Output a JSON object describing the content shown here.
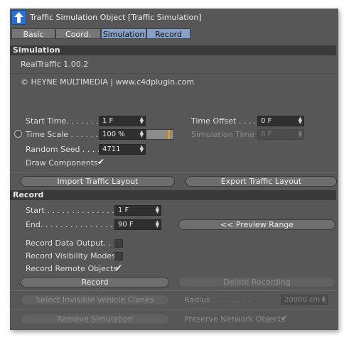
{
  "window": {
    "title": "Traffic Simulation Object [Traffic Simulation]"
  },
  "tabs": [
    {
      "label": "Basic",
      "active": false
    },
    {
      "label": "Coord.",
      "active": false
    },
    {
      "label": "Simulation",
      "active": true
    },
    {
      "label": "Record",
      "active": true
    }
  ],
  "simulation": {
    "header": "Simulation",
    "version": "RealTraffic 1.00.2",
    "copyright": "© HEYNE MULTIMEDIA  |  www.c4dplugin.com",
    "start_time": {
      "label": "Start Time. . . . . . . . .",
      "value": "1 F"
    },
    "time_offset": {
      "label": "Time Offset . . . .",
      "value": "0 F"
    },
    "time_scale": {
      "label": "Time Scale . . . . . . . .",
      "value": "100 %",
      "slider_fraction": 0.85
    },
    "simulation_time": {
      "label": "Simulation Time",
      "value": "0 F"
    },
    "random_seed": {
      "label": "Random Seed . . . .",
      "value": "4711"
    },
    "draw_components": {
      "label": "Draw Components",
      "checked": true
    },
    "import_button": "Import Traffic Layout",
    "export_button": "Export Traffic Layout"
  },
  "record": {
    "header": "Record",
    "start": {
      "label": "Start . . . . . . . . . . . . . . . .",
      "value": "1 F"
    },
    "end": {
      "label": "End. . . . . . . . . . . . . . . . . .",
      "value": "90 F"
    },
    "preview_button": "<< Preview Range",
    "record_data_output": {
      "label": "Record Data Output. . .",
      "checked": false
    },
    "record_visibility_modes": {
      "label": "Record Visibility Modes",
      "checked": false
    },
    "record_remote_objects": {
      "label": "Record Remote Objects",
      "checked": true
    },
    "record_button": "Record",
    "delete_button": "Delete Recording",
    "select_invisible_button": "Select Invisible Vehicle Clones",
    "radius": {
      "label": "Radius . . . . . . . .",
      "value": "20000 cm"
    },
    "remove_button": "Remove Simulation",
    "preserve": {
      "label": "Preserve Network Objects",
      "checked": true
    }
  },
  "icons": {
    "title": "up-arrow-icon",
    "check": "checkmark-icon",
    "radio": "radio-icon",
    "spin": "spinner-arrows-icon"
  },
  "colors": {
    "window_bg": "#575757",
    "header_bg": "#3a3a3a",
    "active_tab": "#86a0c8",
    "accent_slider": "#e09a1a",
    "title_icon": "#2a6fd1"
  }
}
